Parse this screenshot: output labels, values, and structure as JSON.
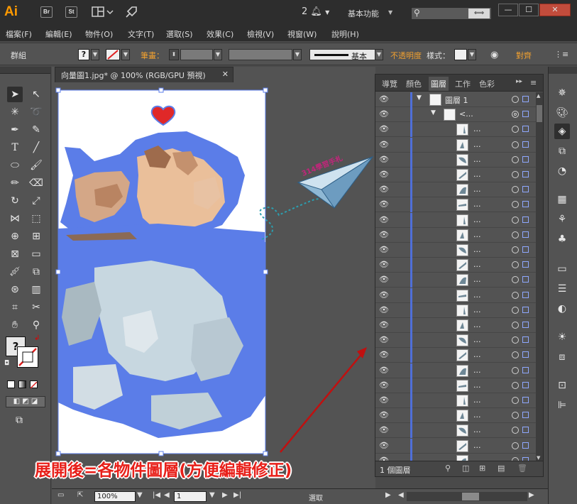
{
  "titlebar": {
    "logo": "Ai",
    "bridge": "Br",
    "stock": "St",
    "notification_count": "2",
    "workspace": "基本功能",
    "search_button": "⟺"
  },
  "menu": [
    "檔案(F)",
    "編輯(E)",
    "物件(O)",
    "文字(T)",
    "選取(S)",
    "效果(C)",
    "檢視(V)",
    "視窗(W)",
    "說明(H)"
  ],
  "control": {
    "selection": "群組",
    "stroke_label": "筆畫：",
    "stroke_style": "基本",
    "opacity_label": "不透明度",
    "style_label": "樣式：",
    "align_label": "對齊"
  },
  "document": {
    "tab_title": "向量圖1.jpg* @ 100% (RGB/GPU 預視)"
  },
  "annotation": {
    "stamp": "314學習手札",
    "caption": "展開後=各物件圖層(方便編輯修正)"
  },
  "layers_panel": {
    "tabs": [
      "導覽",
      "顏色",
      "圖層",
      "工作",
      "色彩"
    ],
    "layer_name": "圖層 1",
    "group_name": "<...",
    "item_name": "...",
    "item_count": 23,
    "footer_count": "1 個圖層"
  },
  "status": {
    "zoom": "100%",
    "page": "1",
    "mode": "選取"
  },
  "colors": {
    "accent_orange": "#ff9a00",
    "path_blue": "#5b7de8",
    "caption_red": "#e8201a",
    "layer_bar": "#4f6fd8"
  }
}
